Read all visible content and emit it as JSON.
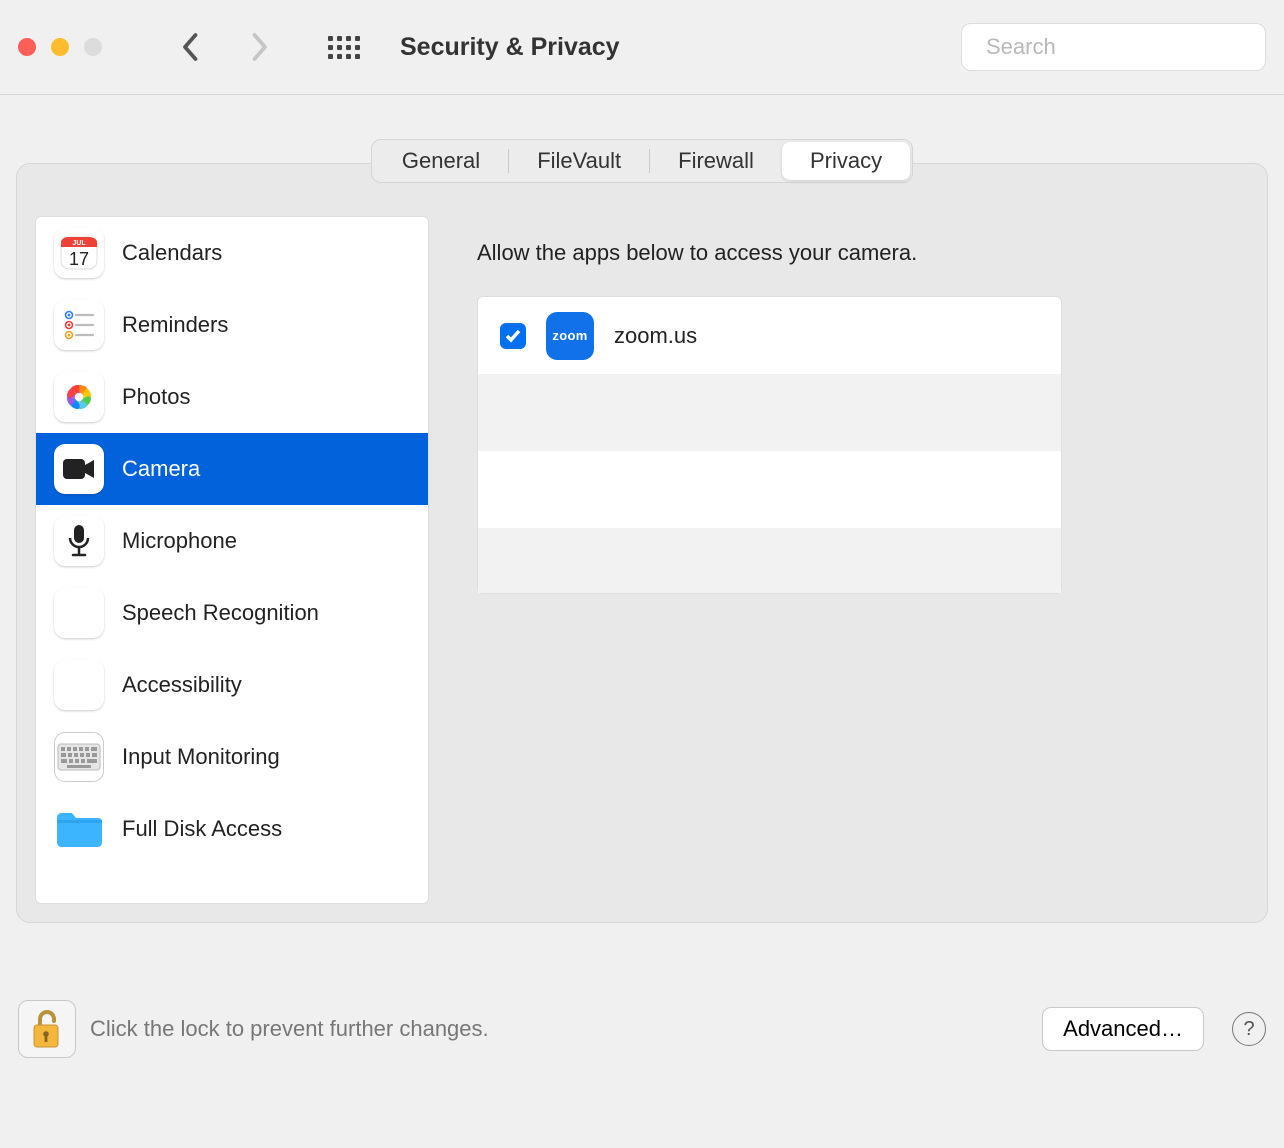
{
  "window": {
    "title": "Security & Privacy"
  },
  "search": {
    "placeholder": "Search"
  },
  "tabs": {
    "general": "General",
    "filevault": "FileVault",
    "firewall": "Firewall",
    "privacy": "Privacy",
    "active": "privacy"
  },
  "sidebar": {
    "items": [
      {
        "id": "calendars",
        "label": "Calendars",
        "icon": "calendar-icon"
      },
      {
        "id": "reminders",
        "label": "Reminders",
        "icon": "reminders-icon"
      },
      {
        "id": "photos",
        "label": "Photos",
        "icon": "photos-icon"
      },
      {
        "id": "camera",
        "label": "Camera",
        "icon": "camera-icon",
        "selected": true
      },
      {
        "id": "microphone",
        "label": "Microphone",
        "icon": "microphone-icon"
      },
      {
        "id": "speech-recognition",
        "label": "Speech Recognition",
        "icon": "speech-icon"
      },
      {
        "id": "accessibility",
        "label": "Accessibility",
        "icon": "accessibility-icon"
      },
      {
        "id": "input-monitoring",
        "label": "Input Monitoring",
        "icon": "keyboard-icon"
      },
      {
        "id": "full-disk-access",
        "label": "Full Disk Access",
        "icon": "folder-icon"
      }
    ]
  },
  "detail": {
    "heading": "Allow the apps below to access your camera.",
    "apps": [
      {
        "name": "zoom.us",
        "checked": true,
        "icon_color": "#1171e9",
        "icon_label": "zoom"
      }
    ],
    "empty_rows": 3
  },
  "footer": {
    "lock_text": "Click the lock to prevent further changes.",
    "advanced_label": "Advanced…",
    "help_label": "?"
  },
  "calendar_icon": {
    "month": "JUL",
    "day": "17"
  }
}
